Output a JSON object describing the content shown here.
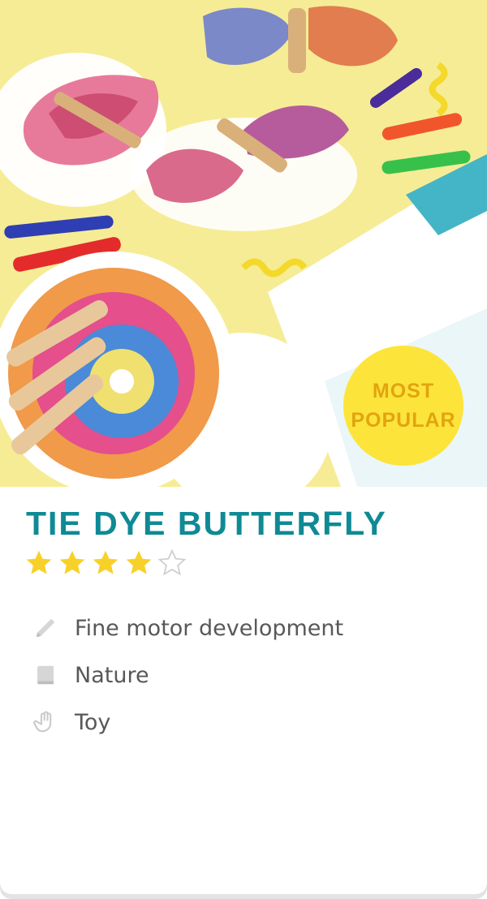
{
  "product": {
    "title": "TIE DYE BUTTERFLY",
    "badge": {
      "line1": "MOST",
      "line2": "POPULAR"
    },
    "rating": {
      "value": 4,
      "max": 5
    },
    "features": [
      {
        "icon": "pencil-icon",
        "label": "Fine motor development"
      },
      {
        "icon": "book-icon",
        "label": "Nature"
      },
      {
        "icon": "hand-icon",
        "label": "Toy"
      }
    ]
  },
  "colors": {
    "title": "#0f8a95",
    "star_filled": "#f7d12a",
    "badge_bg": "#fde43a",
    "badge_text": "#e2a40f",
    "hero_bg": "#f6ec95"
  }
}
